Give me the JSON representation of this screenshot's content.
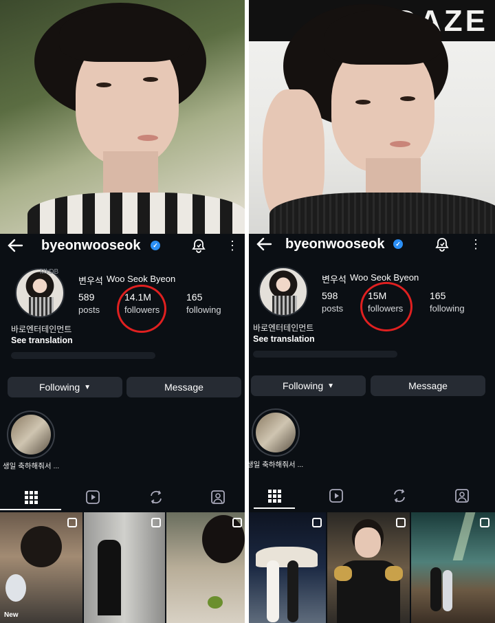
{
  "left": {
    "username": "byeonwooseok",
    "korean_name": "변우석",
    "english_name": "Woo Seok Byeon",
    "watermark": "MkDB",
    "posts_count": "589",
    "posts_label": "posts",
    "followers_count": "14.1M",
    "followers_label": "followers",
    "following_count": "165",
    "following_label": "following",
    "bio_line": "바로엔터테인먼트",
    "see_translation": "See translation",
    "following_button": "Following",
    "message_button": "Message",
    "highlight_label": "생일 축하해줘서 ...",
    "new_label": "New"
  },
  "right": {
    "username": "byeonwooseok",
    "korean_name": "변우석",
    "english_name": "Woo Seok Byeon",
    "posts_count": "598",
    "posts_label": "posts",
    "followers_count": "15M",
    "followers_label": "followers",
    "following_count": "165",
    "following_label": "following",
    "bio_line": "바로엔터테인먼트",
    "see_translation": "See translation",
    "following_button": "Following",
    "message_button": "Message",
    "highlight_label": "생일 축하해줘서 ..."
  },
  "icons": {
    "back": "back-arrow-icon",
    "verified": "verified-badge-icon",
    "bell": "notification-bell-icon",
    "more": "more-options-icon",
    "grid": "grid-icon",
    "reels": "reels-icon",
    "reposts": "reposts-icon",
    "tagged": "tagged-icon",
    "multi": "multi-photo-icon"
  },
  "colors": {
    "background": "#0b0f14",
    "button": "#262b33",
    "verified": "#2b8ff6",
    "circle_highlight": "#e02020"
  }
}
